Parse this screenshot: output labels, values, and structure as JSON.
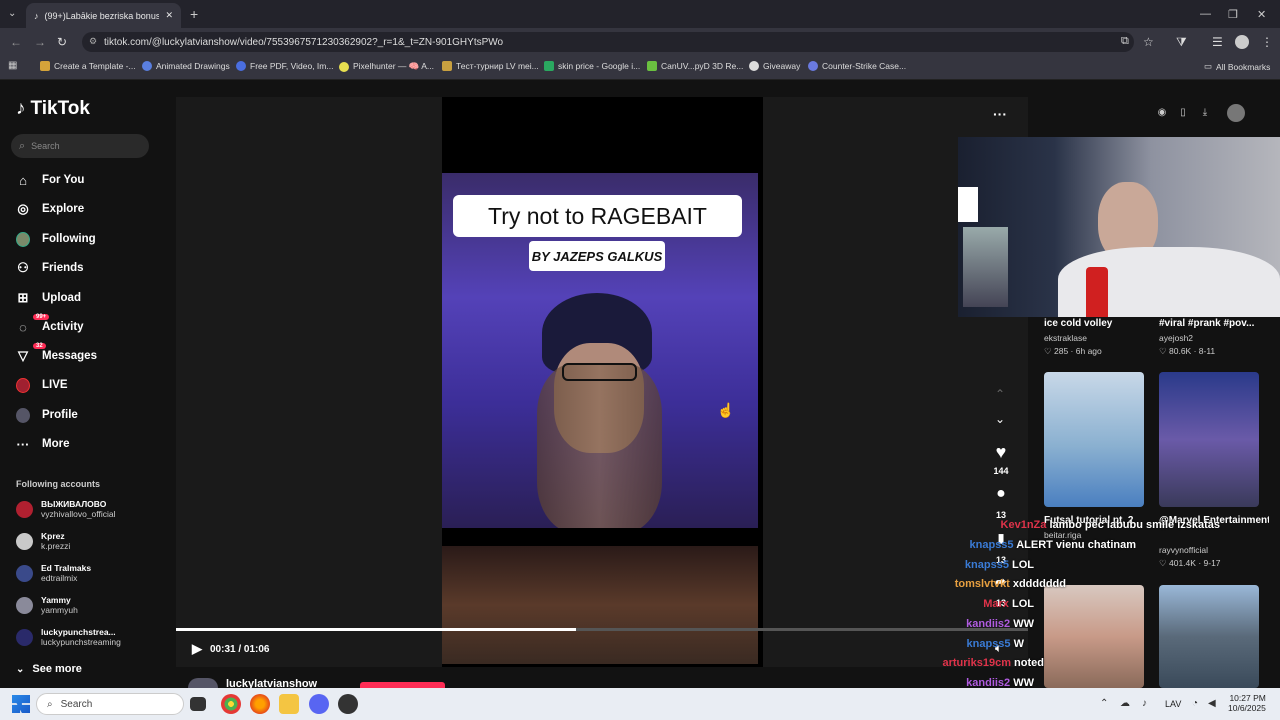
{
  "browser": {
    "tab_title": "(99+)Labākie bezriska bonusi p",
    "url": "tiktok.com/@luckylatvianshow/video/7553967571230362902?_r=1&_t=ZN-901GHYtsPWo",
    "bookmarks": [
      "Create a Template -...",
      "Animated Drawings",
      "Free PDF, Video, Im...",
      "Pixelhunter — 🧠 A...",
      "Тест-турнир LV mei...",
      "skin price - Google i...",
      "CanUV...pyD 3D Re...",
      "Giveaway",
      "Counter-Strike Case..."
    ],
    "all_bookmarks": "All Bookmarks"
  },
  "sidebar": {
    "logo": "TikTok",
    "search_placeholder": "Search",
    "nav": [
      {
        "label": "For You",
        "icon": "home-icon"
      },
      {
        "label": "Explore",
        "icon": "compass-icon"
      },
      {
        "label": "Following",
        "icon": "following-avatar-icon"
      },
      {
        "label": "Friends",
        "icon": "friends-icon"
      },
      {
        "label": "Upload",
        "icon": "upload-icon"
      },
      {
        "label": "Activity",
        "icon": "activity-icon",
        "badge": "99+"
      },
      {
        "label": "Messages",
        "icon": "messages-icon",
        "badge": "32"
      },
      {
        "label": "LIVE",
        "icon": "live-icon"
      },
      {
        "label": "Profile",
        "icon": "profile-avatar-icon"
      },
      {
        "label": "More",
        "icon": "more-icon"
      }
    ],
    "following_header": "Following accounts",
    "accounts": [
      {
        "name": "ВЫЖИВАЛОВО",
        "handle": "vyzhivallovo_official"
      },
      {
        "name": "Kprez",
        "handle": "k.prezzi"
      },
      {
        "name": "Ed Tralmaks",
        "handle": "edtrailmix"
      },
      {
        "name": "Yammy",
        "handle": "yammyuh"
      },
      {
        "name": "luckypunchstrea...",
        "handle": "luckypunchstreaming"
      }
    ],
    "see_more": "See more"
  },
  "video": {
    "title_overlay": "Try not to RAGEBAIT",
    "subtitle_overlay": "BY JAZEPS GALKUS",
    "time": "00:31 / 01:06",
    "progress": 0.47,
    "author_partial": "luckylatvianshow"
  },
  "actions": {
    "likes": "144",
    "comments": "13",
    "saves": "13",
    "shares": "13"
  },
  "cards": [
    {
      "title": "ice cold volley",
      "author": "ekstraklase",
      "likes": "285",
      "date": "6h ago"
    },
    {
      "title": "#viral #prank #pov...",
      "author": "ayejosh2",
      "likes": "80.6K",
      "date": "8-11"
    },
    {
      "title": "Futsal tutorial pt. 2",
      "author": "beitar.riga",
      "likes": "",
      "date": ""
    },
    {
      "title": "@Marvel Entertainment @th...",
      "author": "rayvynofficial",
      "likes": "401.4K",
      "date": "9-17"
    }
  ],
  "chat": [
    {
      "user": "Kev1nZa",
      "msg": "lambo pēc labubu smile izskatās",
      "color": "#e0334a"
    },
    {
      "user": "knapss5",
      "msg": "ALERT vienu chatinam",
      "color": "#3a7bd5"
    },
    {
      "user": "knapss5",
      "msg": "LOL",
      "color": "#3a7bd5"
    },
    {
      "user": "tomslvtvkt",
      "msg": "xddddddd",
      "color": "#e8a040"
    },
    {
      "user": "Marx",
      "msg": "LOL",
      "color": "#e0334a"
    },
    {
      "user": "kandiis2",
      "msg": "WW",
      "color": "#b05ce0"
    },
    {
      "user": "knapss5",
      "msg": "W",
      "color": "#3a7bd5"
    },
    {
      "user": "arturiks19cm",
      "msg": "noted",
      "color": "#e0334a"
    },
    {
      "user": "kandiis2",
      "msg": "WW",
      "color": "#b05ce0"
    }
  ],
  "taskbar": {
    "search": "Search",
    "lang": "LAV",
    "time": "10:27 PM",
    "date": "10/6/2025"
  }
}
